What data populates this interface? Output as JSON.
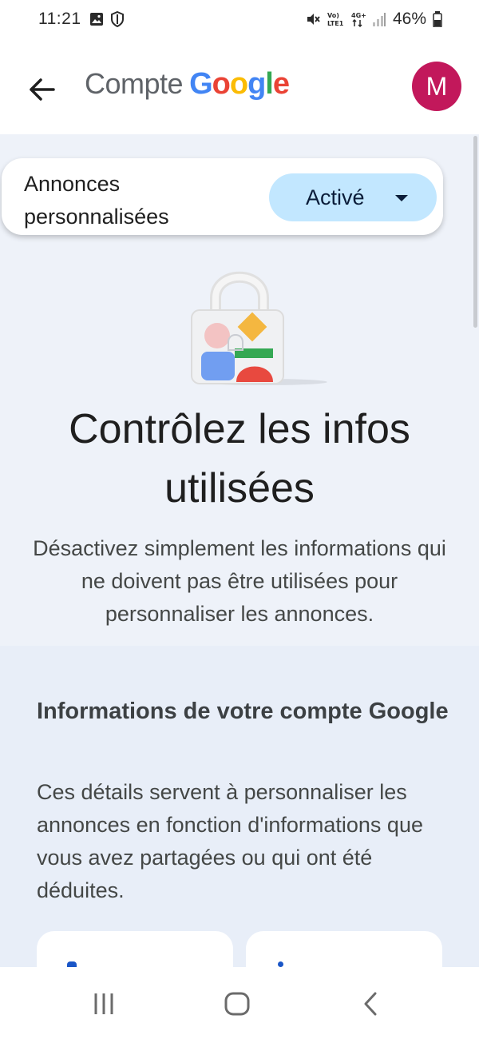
{
  "status_bar": {
    "time": "11:21",
    "battery": "46%",
    "icons": [
      "gallery-icon",
      "shield-icon",
      "mute-icon",
      "volte-icon",
      "4g-icon",
      "signal-icon",
      "battery-icon"
    ]
  },
  "app_bar": {
    "title_prefix": "Compte",
    "title_brand_letters": [
      "G",
      "o",
      "o",
      "g",
      "l",
      "e"
    ],
    "brand_colors": [
      "#4285F4",
      "#EA4335",
      "#FBBC05",
      "#4285F4",
      "#34A853",
      "#EA4335"
    ],
    "avatar_initial": "M",
    "avatar_color": "#c2185b"
  },
  "ads_toggle": {
    "label": "Annonces personnalisées",
    "value": "Activé"
  },
  "hero": {
    "title": "Contrôlez les infos utilisées",
    "description": "Désactivez simplement les informations qui ne doivent pas être utilisées pour personnaliser les annonces."
  },
  "section": {
    "title": "Informations de votre compte Google",
    "description": "Ces détails servent à personnaliser les annonces en fonction d'informations que vous avez partagées ou qui ont été déduites."
  }
}
